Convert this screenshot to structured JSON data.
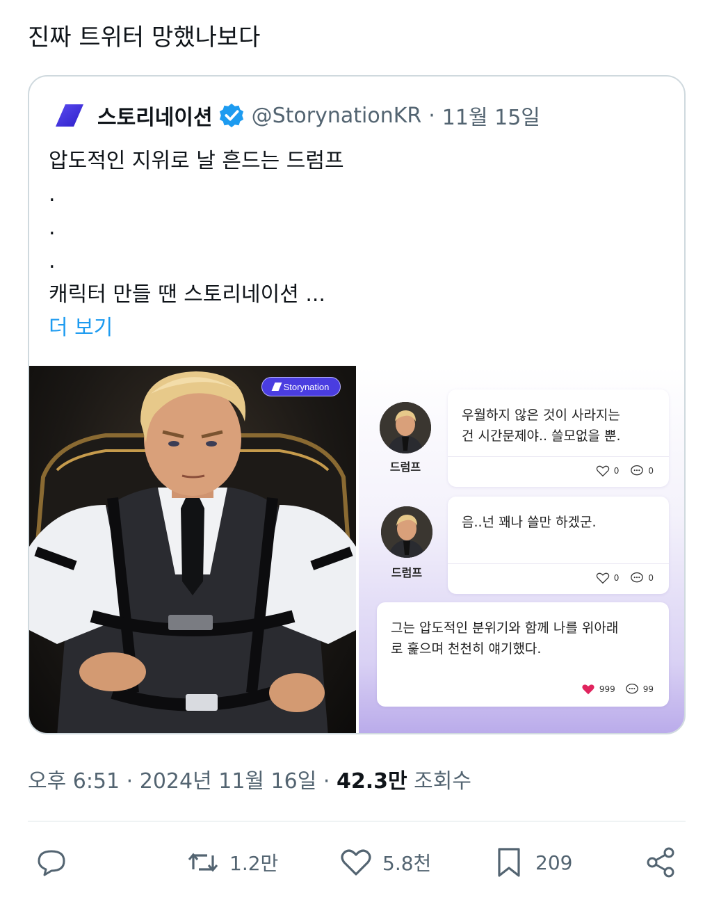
{
  "post": {
    "text": "진짜 트위터 망했나보다"
  },
  "quote": {
    "name": "스토리네이션",
    "handle": "@StorynationKR",
    "separator": "·",
    "date": "11월 15일",
    "lines": [
      "압도적인 지위로 날 흔드는 드럼프",
      ".",
      ".",
      ".",
      "캐릭터 만들 땐 스토리네이션 ..."
    ],
    "more": "더 보기",
    "badge": "Storynation"
  },
  "chat": {
    "messages": [
      {
        "author": "드럼프",
        "line1": "우월하지 않은 것이 사라지는",
        "line2": "건 시간문제야.. 쓸모없을 뿐.",
        "likes": "0",
        "comments": "0"
      },
      {
        "author": "드럼프",
        "line1": "음..넌 꽤나 쓸만 하겠군.",
        "line2": "",
        "likes": "0",
        "comments": "0"
      },
      {
        "author": "",
        "line1": "그는 압도적인 분위기와 함께 나를 위아래",
        "line2": "로 훑으며 천천히 얘기했다.",
        "likes": "999",
        "comments": "99"
      }
    ]
  },
  "meta": {
    "time": "오후 6:51",
    "sep1": "·",
    "date": "2024년 11월 16일",
    "sep2": "·",
    "views": "42.3만",
    "views_label": "조회수"
  },
  "actions": {
    "reply": "",
    "retweets": "1.2만",
    "likes": "5.8천",
    "bookmarks": "209"
  },
  "colors": {
    "link": "#1d9bf0",
    "verified": "#1d9bf0",
    "brand": "#4a3de0",
    "heart": "#e0245e",
    "muted": "#536471"
  }
}
